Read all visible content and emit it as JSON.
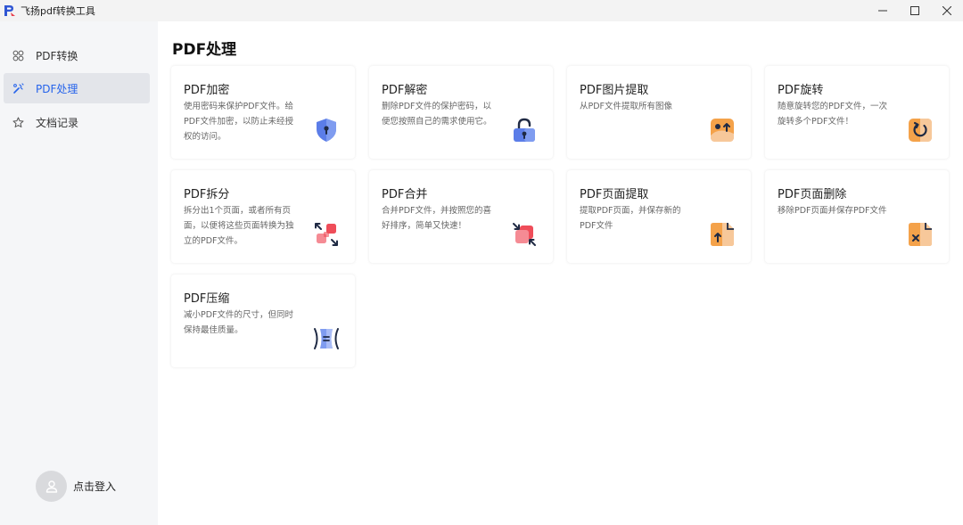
{
  "window": {
    "title": "飞扬pdf转换工具",
    "controls": [
      "minimize",
      "maximize",
      "close"
    ]
  },
  "sidebar": {
    "items": [
      {
        "label": "PDF转换",
        "icon": "grid-icon",
        "active": false
      },
      {
        "label": "PDF处理",
        "icon": "tools-icon",
        "active": true
      },
      {
        "label": "文档记录",
        "icon": "star-icon",
        "active": false
      }
    ],
    "login_label": "点击登入"
  },
  "main": {
    "title": "PDF处理",
    "cards": [
      {
        "title": "PDF加密",
        "desc": "使用密码来保护PDF文件。给PDF文件加密，以防止未经授权的访问。",
        "icon": "shield-lock-icon"
      },
      {
        "title": "PDF解密",
        "desc": "删除PDF文件的保护密码，以便您按照自己的需求使用它。",
        "icon": "unlock-icon"
      },
      {
        "title": "PDF图片提取",
        "desc": "从PDF文件提取所有图像",
        "icon": "image-extract-icon"
      },
      {
        "title": "PDF旋转",
        "desc": "随意旋转您的PDF文件，一次旋转多个PDF文件！",
        "icon": "rotate-icon"
      },
      {
        "title": "PDF拆分",
        "desc": "拆分出1个页面，或者所有页面，以便将这些页面转换为独立的PDF文件。",
        "icon": "split-icon"
      },
      {
        "title": "PDF合并",
        "desc": "合并PDF文件，并按照您的喜好排序，简单又快速！",
        "icon": "merge-icon"
      },
      {
        "title": "PDF页面提取",
        "desc": "提取PDF页面，并保存新的PDF文件",
        "icon": "page-extract-icon"
      },
      {
        "title": "PDF页面删除",
        "desc": "移除PDF页面并保存PDF文件",
        "icon": "page-delete-icon"
      },
      {
        "title": "PDF压缩",
        "desc": "减小PDF文件的尺寸，但同时保持最佳质量。",
        "icon": "compress-icon"
      }
    ]
  },
  "colors": {
    "accent": "#2563eb",
    "icon_blue": "#5b7de8",
    "icon_red": "#ef4d59",
    "icon_orange": "#f4a24a"
  }
}
